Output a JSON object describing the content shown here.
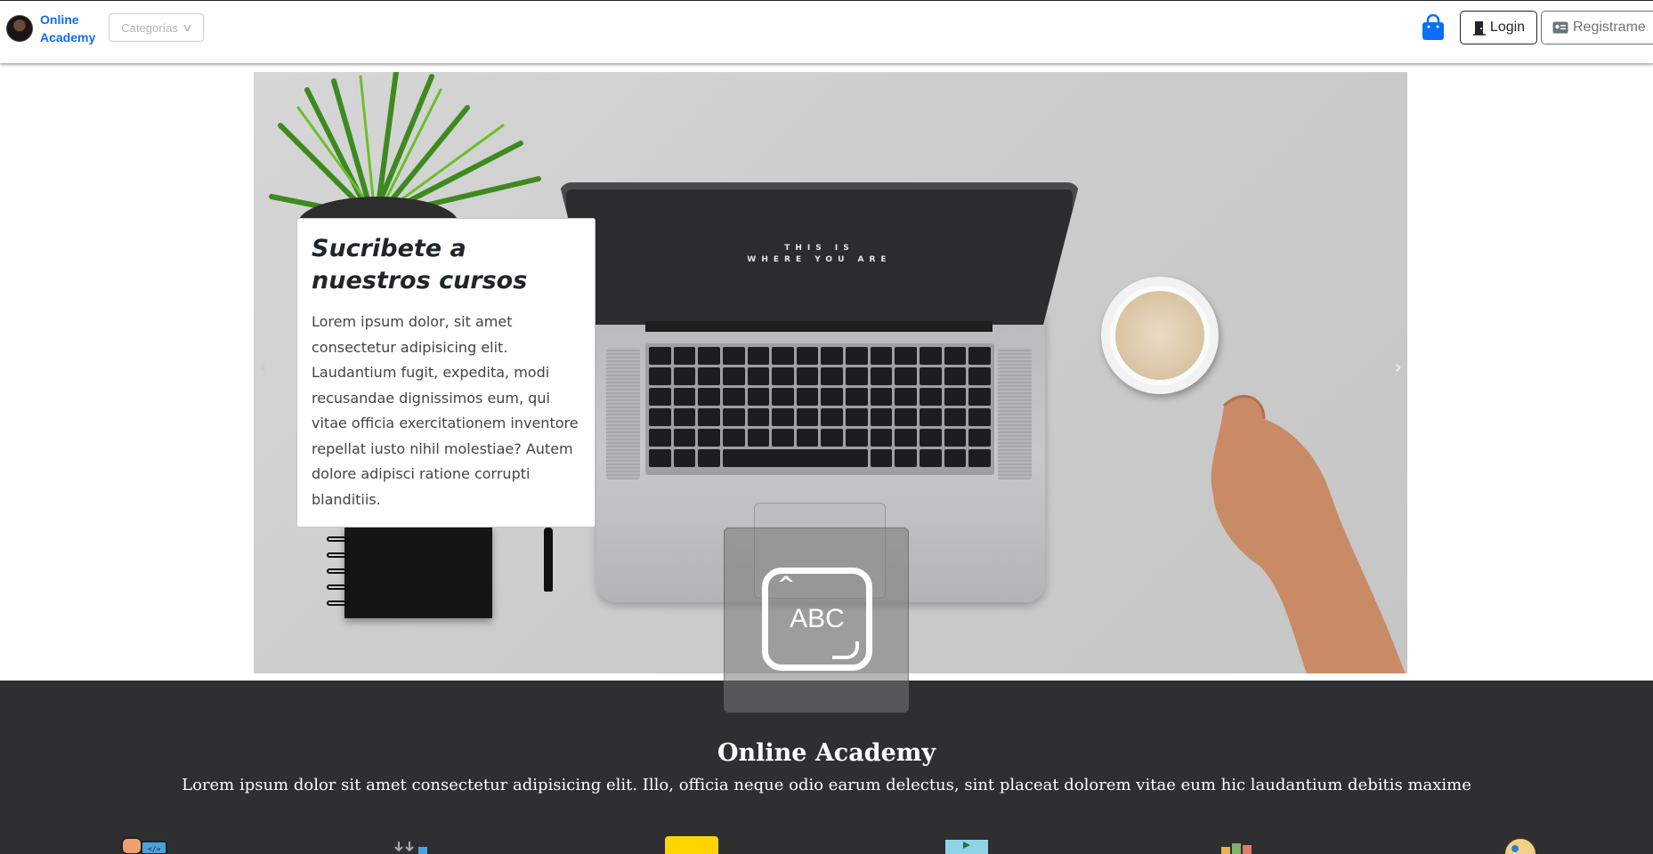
{
  "navbar": {
    "brand_line1": "Online",
    "brand_line2": "Academy",
    "logo_icon": "brand-logo-icon",
    "categories_label": "Categorías",
    "cart_icon": "shopping-bag-icon",
    "login_label": "Login",
    "register_label": "Registrame",
    "accent_color": "#0d6efd"
  },
  "carousel": {
    "screen_text_line1": "THIS IS",
    "screen_text_line2": "WHERE YOU ARE",
    "caption_title": "Sucribete a nuestros cursos",
    "caption_text": "Lorem ipsum dolor, sit amet consectetur adipisicing elit. Laudantium fugit, expedita, modi recusandae dignissimos eum, qui vitae officia exercitationem inventore repellat iusto nihil molestiae? Autem dolore adipisci ratione corrupti blanditiis.",
    "prev_icon": "chevron-left-icon",
    "next_icon": "chevron-right-icon"
  },
  "ime_overlay": {
    "label": "ABC"
  },
  "about": {
    "title": "Online Academy",
    "subtitle": "Lorem ipsum dolor sit amet consectetur adipisicing elit. Illo, officia neque odio earum delectus, sint placeat dolorem vitae eum hic laudantium debitis maxime",
    "background_color": "#2f2e31"
  }
}
